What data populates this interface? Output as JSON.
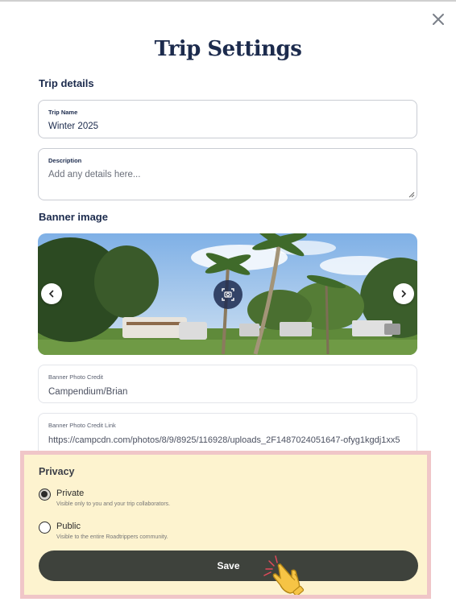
{
  "dialog": {
    "title": "Trip Settings"
  },
  "trip_details": {
    "heading": "Trip details",
    "trip_name": {
      "label": "Trip Name",
      "value": "Winter 2025"
    },
    "description": {
      "label": "Description",
      "placeholder": "Add any details here..."
    }
  },
  "banner": {
    "heading": "Banner image",
    "photo_credit": {
      "label": "Banner Photo Credit",
      "value": "Campendium/Brian"
    },
    "photo_credit_link": {
      "label": "Banner Photo Credit Link",
      "value": "https://campcdn.com/photos/8/9/8925/116928/uploads_2F1487024051647-ofyg1kgdj1xx5"
    }
  },
  "privacy": {
    "heading": "Privacy",
    "options": [
      {
        "label": "Private",
        "description": "Visible only to you and your trip collaborators.",
        "selected": true
      },
      {
        "label": "Public",
        "description": "Visible to the entire Roadtrippers community.",
        "selected": false
      }
    ]
  },
  "actions": {
    "save_label": "Save"
  },
  "icons": {
    "close": "close-icon",
    "prev": "chevron-left-icon",
    "next": "chevron-right-icon",
    "camera": "camera-icon",
    "cursor": "pointer-hand-icon"
  },
  "colors": {
    "title": "#1c2b4d",
    "save_button": "#3e423c",
    "privacy_highlight": "#fdf3cf",
    "privacy_border": "#f0c6c8"
  }
}
